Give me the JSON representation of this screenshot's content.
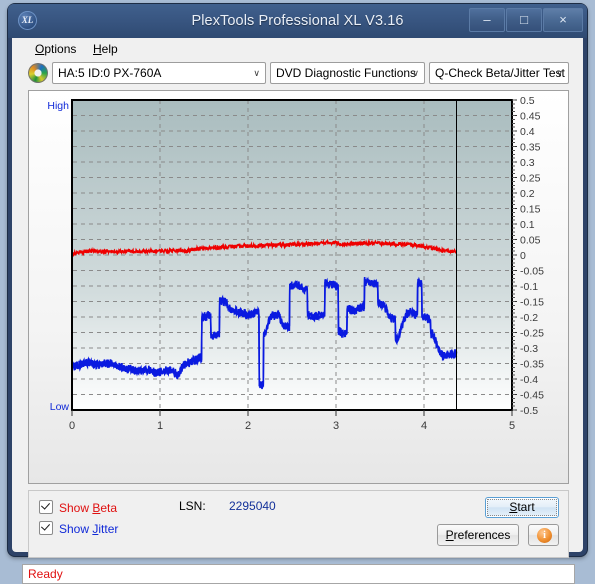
{
  "window": {
    "title": "PlexTools Professional XL V3.16",
    "app_icon": "XL",
    "minimize": "–",
    "maximize": "□",
    "close": "×"
  },
  "menubar": {
    "items": [
      {
        "label": "Options",
        "mnemonic": "O"
      },
      {
        "label": "Help",
        "mnemonic": "H"
      }
    ]
  },
  "toolbar": {
    "drive_icon": "cd-disc-icon",
    "drive": "HA:5 ID:0  PX-760A",
    "function": "DVD Diagnostic Functions",
    "test": "Q-Check Beta/Jitter Test",
    "dropdown_arrow": "∨"
  },
  "controls": {
    "show_beta": "Show Beta",
    "show_beta_checked": true,
    "show_jitter": "Show Jitter",
    "show_jitter_checked": true,
    "lsn_label": "LSN:",
    "lsn_value": "2295040",
    "start": "Start",
    "preferences": "Preferences",
    "info": "i"
  },
  "statusbar": {
    "text": "Ready"
  },
  "colors": {
    "beta": "#ee0000",
    "jitter": "#0a1ae0",
    "plot_top": "#a9bcbe",
    "plot_bottom": "#ffffff",
    "grid": "#8a8a8a",
    "axis_text": "#3a3a3a",
    "hint_text": "#1029d8",
    "status_text": "#e01010",
    "titlebar": "#35527c"
  },
  "chart_data": {
    "type": "line",
    "title": "Q-Check Beta/Jitter Test",
    "xlabel": "",
    "ylabel": "",
    "xlim": [
      0,
      5
    ],
    "ylim": [
      -0.5,
      0.5
    ],
    "xticks": [
      0,
      1,
      2,
      3,
      4,
      5
    ],
    "yticks": [
      0.5,
      0.45,
      0.4,
      0.35,
      0.3,
      0.25,
      0.2,
      0.15,
      0.1,
      0.05,
      0,
      -0.05,
      -0.1,
      -0.15,
      -0.2,
      -0.25,
      -0.3,
      -0.35,
      -0.4,
      -0.45,
      -0.5
    ],
    "grid": true,
    "legend_position": "below-left",
    "annotations": {
      "high_label": "High",
      "low_label": "Low",
      "data_end_marker_x": 4.37
    },
    "series": [
      {
        "name": "Beta",
        "color": "#ee0000",
        "x": [
          0.0,
          0.09,
          0.18,
          0.27,
          0.36,
          0.45,
          0.55,
          0.64,
          0.73,
          0.82,
          0.91,
          1.0,
          1.09,
          1.18,
          1.27,
          1.36,
          1.46,
          1.55,
          1.64,
          1.73,
          1.82,
          1.91,
          2.0,
          2.09,
          2.18,
          2.27,
          2.37,
          2.46,
          2.55,
          2.64,
          2.73,
          2.82,
          2.91,
          3.0,
          3.09,
          3.18,
          3.28,
          3.37,
          3.46,
          3.55,
          3.64,
          3.73,
          3.82,
          3.91,
          4.0,
          4.09,
          4.19,
          4.28,
          4.37
        ],
        "values": [
          0.005,
          0.01,
          0.012,
          0.013,
          0.012,
          0.01,
          0.011,
          0.012,
          0.011,
          0.01,
          0.012,
          0.013,
          0.014,
          0.016,
          0.012,
          0.017,
          0.02,
          0.022,
          0.024,
          0.026,
          0.027,
          0.028,
          0.029,
          0.03,
          0.031,
          0.032,
          0.032,
          0.033,
          0.034,
          0.035,
          0.036,
          0.038,
          0.04,
          0.04,
          0.034,
          0.036,
          0.037,
          0.038,
          0.038,
          0.037,
          0.036,
          0.035,
          0.034,
          0.032,
          0.028,
          0.022,
          0.016,
          0.012,
          0.01
        ]
      },
      {
        "name": "Jitter",
        "color": "#0a1ae0",
        "x": [
          0.0,
          0.05,
          0.1,
          0.15,
          0.2,
          0.25,
          0.3,
          0.35,
          0.4,
          0.45,
          0.5,
          0.55,
          0.6,
          0.65,
          0.7,
          0.75,
          0.8,
          0.85,
          0.9,
          0.95,
          1.0,
          1.05,
          1.1,
          1.15,
          1.2,
          1.25,
          1.3,
          1.35,
          1.4,
          1.45,
          1.5,
          1.55,
          1.6,
          1.65,
          1.7,
          1.75,
          1.8,
          1.85,
          1.9,
          1.95,
          2.0,
          2.05,
          2.1,
          2.15,
          2.2,
          2.25,
          2.3,
          2.35,
          2.4,
          2.45,
          2.5,
          2.55,
          2.6,
          2.65,
          2.7,
          2.75,
          2.8,
          2.85,
          2.9,
          2.95,
          3.0,
          3.05,
          3.1,
          3.15,
          3.2,
          3.25,
          3.3,
          3.35,
          3.4,
          3.45,
          3.5,
          3.55,
          3.6,
          3.65,
          3.7,
          3.75,
          3.8,
          3.85,
          3.9,
          3.95,
          4.0,
          4.05,
          4.1,
          4.15,
          4.2,
          4.25,
          4.3,
          4.37
        ],
        "values": [
          -0.36,
          -0.355,
          -0.352,
          -0.348,
          -0.345,
          -0.35,
          -0.355,
          -0.352,
          -0.348,
          -0.35,
          -0.36,
          -0.362,
          -0.365,
          -0.368,
          -0.372,
          -0.375,
          -0.372,
          -0.37,
          -0.375,
          -0.38,
          -0.378,
          -0.375,
          -0.372,
          -0.37,
          -0.395,
          -0.36,
          -0.35,
          -0.345,
          -0.34,
          -0.33,
          -0.2,
          -0.195,
          -0.26,
          -0.255,
          -0.145,
          -0.15,
          -0.175,
          -0.18,
          -0.185,
          -0.19,
          -0.195,
          -0.19,
          -0.185,
          -0.42,
          -0.25,
          -0.2,
          -0.195,
          -0.19,
          -0.23,
          -0.235,
          -0.1,
          -0.095,
          -0.105,
          -0.11,
          -0.195,
          -0.2,
          -0.195,
          -0.19,
          -0.09,
          -0.095,
          -0.1,
          -0.25,
          -0.255,
          -0.175,
          -0.18,
          -0.175,
          -0.17,
          -0.085,
          -0.09,
          -0.095,
          -0.155,
          -0.16,
          -0.2,
          -0.205,
          -0.27,
          -0.23,
          -0.19,
          -0.185,
          -0.195,
          -0.09,
          -0.2,
          -0.205,
          -0.255,
          -0.29,
          -0.32,
          -0.325,
          -0.32,
          -0.318
        ]
      }
    ]
  }
}
